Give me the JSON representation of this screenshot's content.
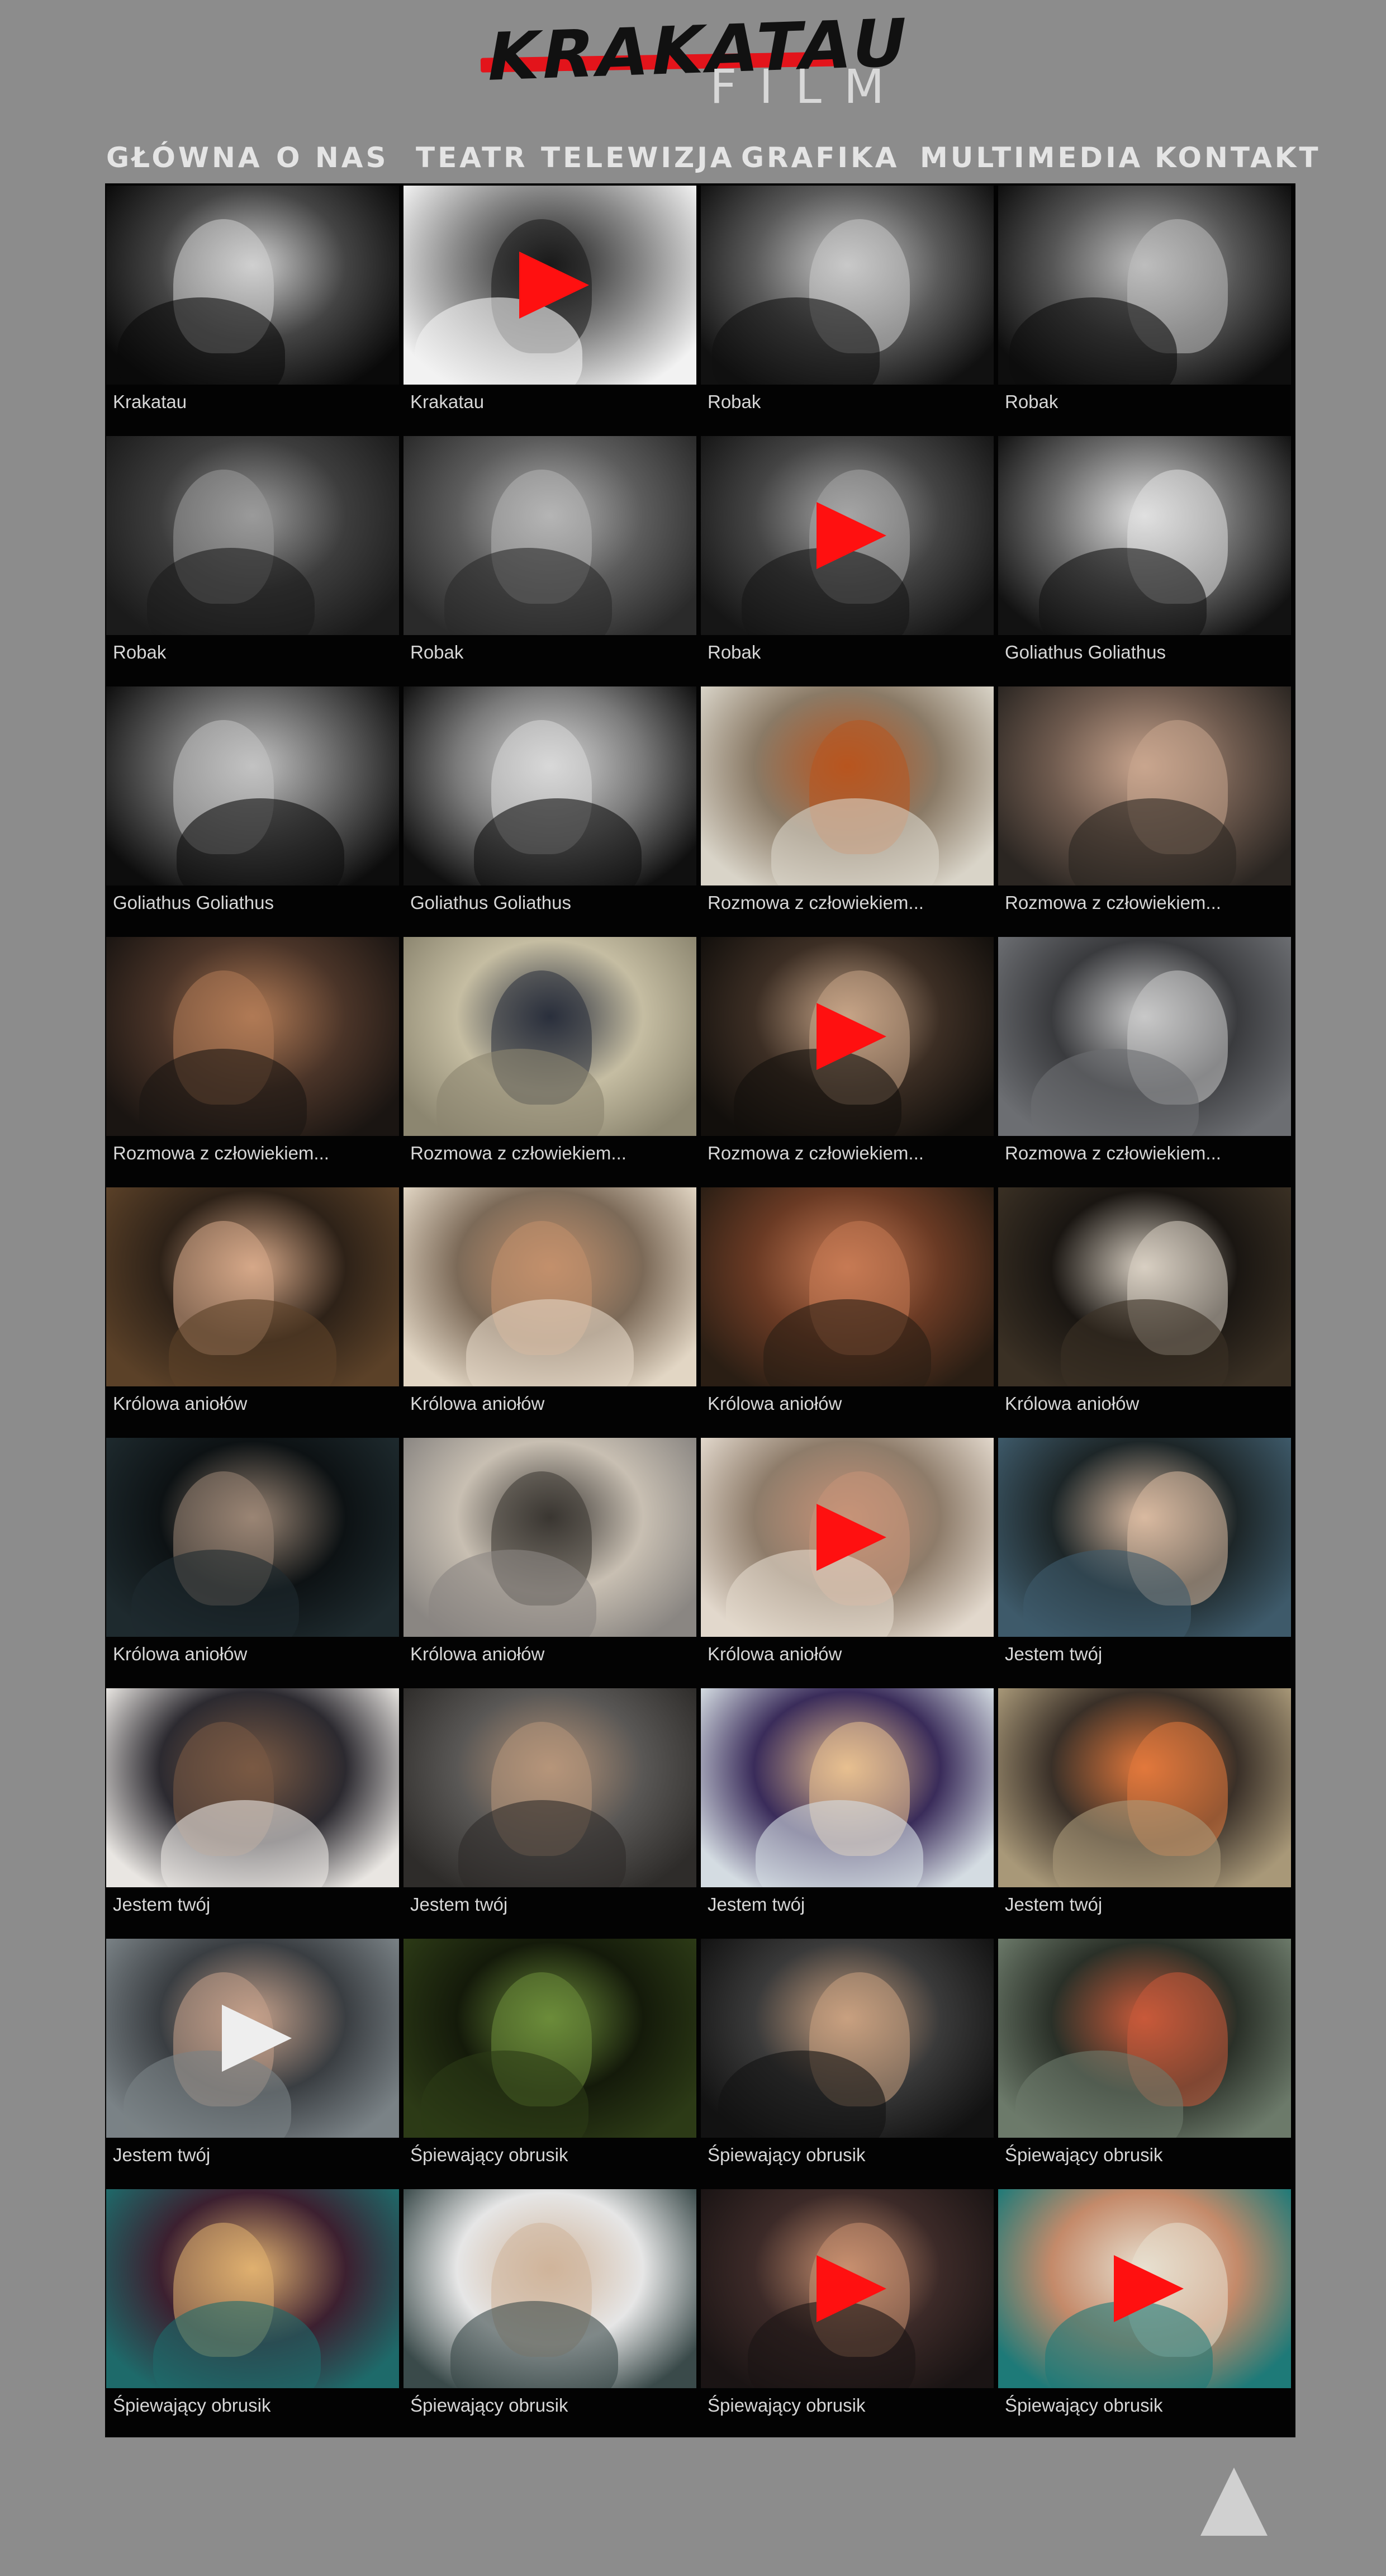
{
  "logo": {
    "word1": "KRAKATAU",
    "word2": "FILM"
  },
  "nav": [
    "GŁÓWNA",
    "O NAS",
    "TEATR",
    "TELEWIZJA",
    "GRAFIKA",
    "MULTIMEDIA",
    "KONTAKT"
  ],
  "gallery": [
    [
      {
        "caption": "Krakatau",
        "palette": [
          "#0a0a0a",
          "#d0d0d0",
          "#444444"
        ],
        "play": false
      },
      {
        "caption": "Krakatau",
        "palette": [
          "#f2f2f2",
          "#1a1a1a",
          "#888888"
        ],
        "play": true
      },
      {
        "caption": "Robak",
        "palette": [
          "#111111",
          "#c9c9c9",
          "#5a5a5a"
        ],
        "play": false
      },
      {
        "caption": "Robak",
        "palette": [
          "#0e0e0e",
          "#bdbdbd",
          "#555555"
        ],
        "play": false
      }
    ],
    [
      {
        "caption": "Robak",
        "palette": [
          "#1b1b1b",
          "#9a9a9a",
          "#3d3d3d"
        ],
        "play": false
      },
      {
        "caption": "Robak",
        "palette": [
          "#2a2a2a",
          "#b5b5b5",
          "#5c5c5c"
        ],
        "play": false
      },
      {
        "caption": "Robak",
        "palette": [
          "#161616",
          "#a5a5a5",
          "#444444"
        ],
        "play": true
      },
      {
        "caption": "Goliathus Goliathus",
        "palette": [
          "#121212",
          "#e0e0e0",
          "#6b6b6b"
        ],
        "play": false
      }
    ],
    [
      {
        "caption": "Goliathus Goliathus",
        "palette": [
          "#0d0d0d",
          "#c2c2c2",
          "#606060"
        ],
        "play": false
      },
      {
        "caption": "Goliathus Goliathus",
        "palette": [
          "#101010",
          "#d8d8d8",
          "#7a7a7a"
        ],
        "play": false
      },
      {
        "caption": "Rozmowa z człowiekiem...",
        "palette": [
          "#d9d4c8",
          "#b8551f",
          "#8a7a66"
        ],
        "play": false
      },
      {
        "caption": "Rozmowa z człowiekiem...",
        "palette": [
          "#2b2622",
          "#c9a58e",
          "#6e5a4e"
        ],
        "play": false
      }
    ],
    [
      {
        "caption": "Rozmowa z człowiekiem...",
        "palette": [
          "#1a1512",
          "#b07a55",
          "#4a3428"
        ],
        "play": false
      },
      {
        "caption": "Rozmowa z człowiekiem...",
        "palette": [
          "#8c8670",
          "#2a2f3c",
          "#c5bda2"
        ],
        "play": false
      },
      {
        "caption": "Rozmowa z człowiekiem...",
        "palette": [
          "#120f0c",
          "#c6a487",
          "#3c2e24"
        ],
        "play": true
      },
      {
        "caption": "Rozmowa z człowiekiem...",
        "palette": [
          "#6c6e72",
          "#c8c8c8",
          "#3a3b3e"
        ],
        "play": false
      }
    ],
    [
      {
        "caption": "Królowa aniołów",
        "palette": [
          "#5b4128",
          "#d6a888",
          "#2e2218"
        ],
        "play": false
      },
      {
        "caption": "Królowa aniołów",
        "palette": [
          "#e2d6c4",
          "#c2906c",
          "#7c6a58"
        ],
        "play": false
      },
      {
        "caption": "Królowa aniołów",
        "palette": [
          "#2a1e14",
          "#c77a54",
          "#6a3a24"
        ],
        "play": false
      },
      {
        "caption": "Królowa aniołów",
        "palette": [
          "#3a3024",
          "#d8cfc2",
          "#1a1612"
        ],
        "play": false
      }
    ],
    [
      {
        "caption": "Królowa aniołów",
        "palette": [
          "#1e2a2e",
          "#9a8574",
          "#0d1214"
        ],
        "play": false
      },
      {
        "caption": "Królowa aniołów",
        "palette": [
          "#8a8682",
          "#3a3632",
          "#c8bfb2"
        ],
        "play": false
      },
      {
        "caption": "Królowa aniołów",
        "palette": [
          "#e2d8cc",
          "#c79378",
          "#8e7c6a"
        ],
        "play": true
      },
      {
        "caption": "Jestem twój",
        "palette": [
          "#3e5a6a",
          "#d9b9a0",
          "#1d2628"
        ],
        "play": false
      }
    ],
    [
      {
        "caption": "Jestem twój",
        "palette": [
          "#e9e6e2",
          "#7a5a44",
          "#2c2a30"
        ],
        "play": false
      },
      {
        "caption": "Jestem twój",
        "palette": [
          "#2e2c2a",
          "#b6957a",
          "#595755"
        ],
        "play": false
      },
      {
        "caption": "Jestem twój",
        "palette": [
          "#d4dce2",
          "#e8c090",
          "#3a2c5a"
        ],
        "play": false
      },
      {
        "caption": "Jestem twój",
        "palette": [
          "#a89878",
          "#e2783c",
          "#3a3028"
        ],
        "play": false
      }
    ],
    [
      {
        "caption": "Jestem twój",
        "palette": [
          "#7a8286",
          "#c4a08a",
          "#3a3e42"
        ],
        "play": true,
        "white": true
      },
      {
        "caption": "Śpiewający obrusik",
        "palette": [
          "#2c3a16",
          "#6c8c3a",
          "#141a0a"
        ],
        "play": false
      },
      {
        "caption": "Śpiewający obrusik",
        "palette": [
          "#121212",
          "#c9a080",
          "#3a3a3a"
        ],
        "play": false
      },
      {
        "caption": "Śpiewający obrusik",
        "palette": [
          "#6c7a6a",
          "#c85a3a",
          "#2a3028"
        ],
        "play": false
      }
    ],
    [
      {
        "caption": "Śpiewający obrusik",
        "palette": [
          "#1e6a6a",
          "#e0b070",
          "#3c2030"
        ],
        "play": false
      },
      {
        "caption": "Śpiewający obrusik",
        "palette": [
          "#3a4a4a",
          "#d0b49a",
          "#e6e6e6"
        ],
        "play": false
      },
      {
        "caption": "Śpiewający obrusik",
        "palette": [
          "#1a1414",
          "#c89070",
          "#3c2a28"
        ],
        "play": true
      },
      {
        "caption": "Śpiewający obrusik",
        "palette": [
          "#1e7a78",
          "#e8e0d0",
          "#c48a6a"
        ],
        "play": true
      }
    ]
  ]
}
